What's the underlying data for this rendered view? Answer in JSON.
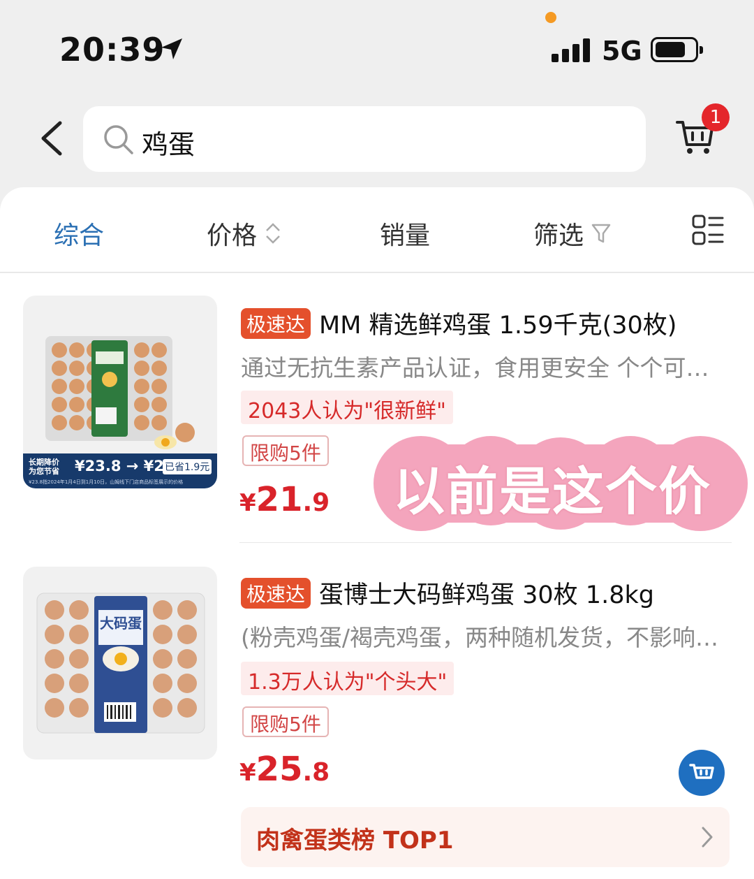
{
  "status_bar": {
    "time": "20:39",
    "network": "5G"
  },
  "search": {
    "query": "鸡蛋"
  },
  "cart": {
    "badge_count": "1"
  },
  "sort_bar": {
    "items": [
      {
        "label": "综合"
      },
      {
        "label": "价格"
      },
      {
        "label": "销量"
      },
      {
        "label": "筛选"
      }
    ]
  },
  "products": [
    {
      "speed_tag": "极速达",
      "title": "MM 精选鲜鸡蛋 1.59千克(30枚)",
      "description": "通过无抗生素产品认证，食用更安全 个个可…",
      "review_tag": "2043人认为\"很新鲜\"",
      "limit_tag": "限购5件",
      "price_currency": "¥",
      "price_int": "21",
      "price_dec": ".9",
      "image_promo": {
        "label_line1": "长期降价",
        "label_line2": "为您节省",
        "price_old": "¥23.8",
        "arrow": "→",
        "price_new": "¥21.9",
        "saving": "已省1.9元",
        "footnote": "¥23.8指2024年1月4日到1月10日，山姆线下门店商品标签展示的价格"
      }
    },
    {
      "speed_tag": "极速达",
      "title": "蛋博士大码鲜鸡蛋 30枚 1.8kg",
      "description": "(粉壳鸡蛋/褐壳鸡蛋，两种随机发货，不影响…",
      "review_tag": "1.3万人认为\"个头大\"",
      "limit_tag": "限购5件",
      "price_currency": "¥",
      "price_int": "25",
      "price_dec": ".8",
      "image_label": "大码蛋",
      "ranking": "肉禽蛋类榜 TOP1"
    }
  ],
  "overlay": {
    "text": "以前是这个价"
  },
  "colors": {
    "accent_blue": "#2a6fb3",
    "price_red": "#d9232a",
    "speed_tag": "#e4502c",
    "overlay_pink": "#f4a5bd"
  }
}
